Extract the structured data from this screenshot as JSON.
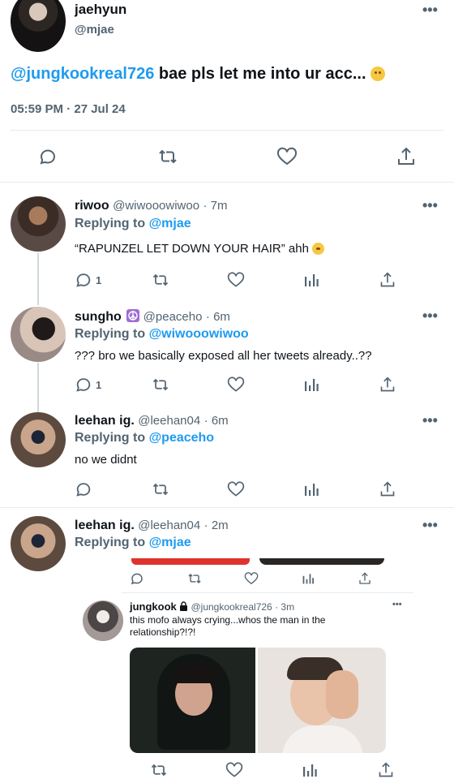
{
  "main_tweet": {
    "display_name": "jaehyun",
    "handle": "@mjae",
    "mention": "@jungkookreal726",
    "text": " bae pls let me into ur acc...",
    "timestamp": "05:59 PM · 27 Jul 24"
  },
  "replies": [
    {
      "display_name": "riwoo",
      "handle": "@wiwooowiwoo",
      "time": "· 7m",
      "replying_label": "Replying to",
      "replying_to": "@mjae",
      "text": "“RAPUNZEL LET DOWN YOUR HAIR” ahh",
      "reply_count": "1"
    },
    {
      "display_name": "sungho",
      "handle": "@peaceho",
      "time": "· 6m",
      "replying_label": "Replying to",
      "replying_to": "@wiwooowiwoo",
      "text": "??? bro we basically exposed all her tweets already..??",
      "reply_count": "1"
    },
    {
      "display_name": "leehan ig.",
      "handle": "@leehan04",
      "time": "· 6m",
      "replying_label": "Replying to",
      "replying_to": "@peaceho",
      "text": "no we didnt",
      "reply_count": ""
    },
    {
      "display_name": "leehan ig.",
      "handle": "@leehan04",
      "time": "· 2m",
      "replying_label": "Replying to",
      "replying_to": "@mjae",
      "text": "",
      "reply_count": ""
    }
  ],
  "quoted_tweet": {
    "display_name": "jungkook",
    "handle": "@jungkookreal726",
    "time": "· 3m",
    "text_line1": "this mofo always crying...whos the man in the",
    "text_line2": "relationship?!?!"
  },
  "icons": {
    "reply": "comment-bubble-icon",
    "retweet": "retweet-icon",
    "like": "heart-icon",
    "views": "analytics-icon",
    "share": "share-icon",
    "more": "more-dots-icon",
    "lock": "lock-icon"
  },
  "colors": {
    "accent": "#1d9bf0",
    "muted": "#536471",
    "text": "#0f1419"
  }
}
